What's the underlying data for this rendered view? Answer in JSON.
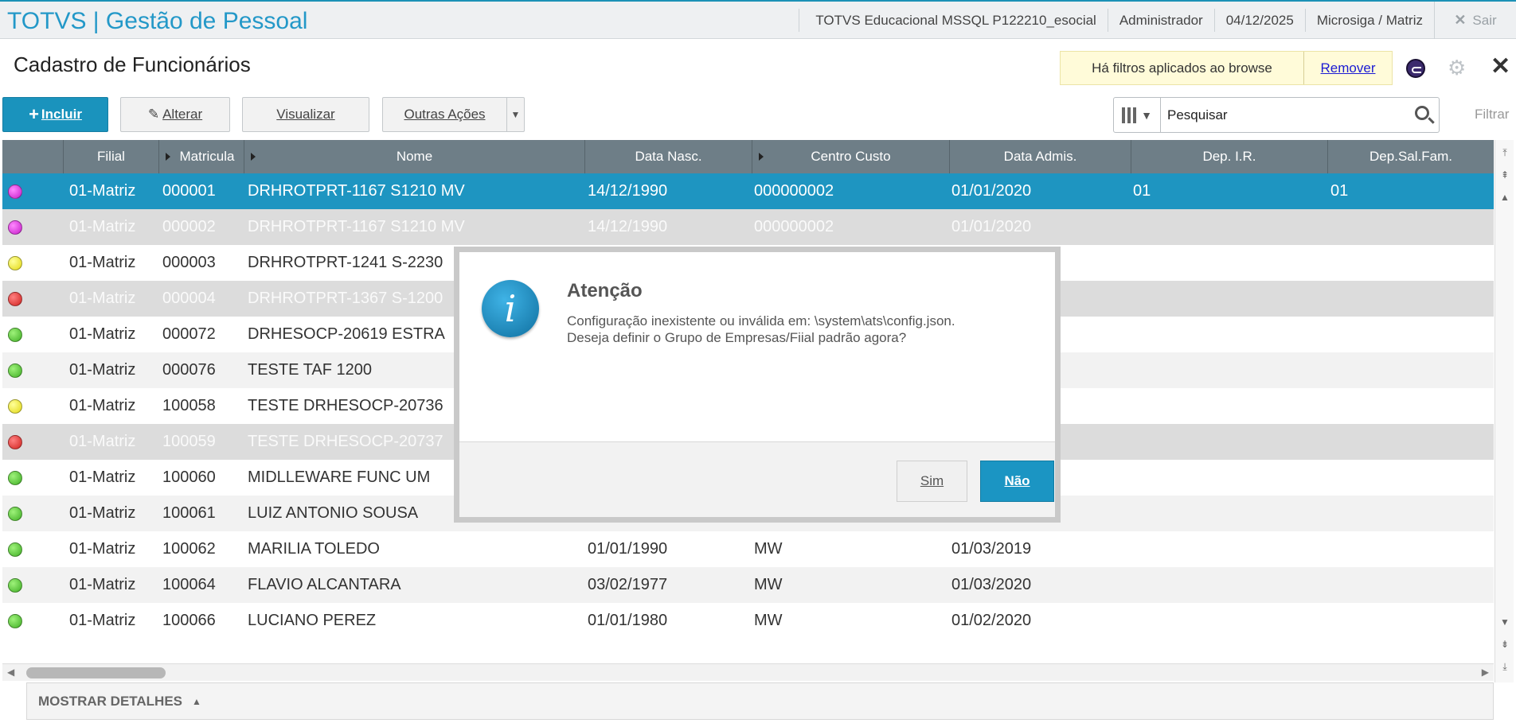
{
  "app": {
    "title": "TOTVS | Gestão de Pessoal",
    "env": "TOTVS Educacional MSSQL P122210_esocial",
    "user": "Administrador",
    "date": "04/12/2025",
    "branch": "Microsiga / Matriz",
    "exit_label": "Sair"
  },
  "page": {
    "title": "Cadastro de Funcionários",
    "filter_notice": "Há filtros aplicados ao browse",
    "filter_remove": "Remover"
  },
  "toolbar": {
    "incluir": "Incluir",
    "alterar": "Alterar",
    "visualizar": "Visualizar",
    "outras_acoes": "Outras Ações",
    "search_placeholder": "Pesquisar",
    "filtrar": "Filtrar"
  },
  "grid": {
    "columns": [
      "Filial",
      "Matricula",
      "Nome",
      "Data Nasc.",
      "Centro Custo",
      "Data Admis.",
      "Dep. I.R.",
      "Dep.Sal.Fam."
    ],
    "rows": [
      {
        "status": "magenta",
        "filial": "01-Matriz",
        "matricula": "000001",
        "nome": "DRHROTPRT-1167 S1210 MV",
        "nasc": "14/12/1990",
        "cc": "000000002",
        "admis": "01/01/2020",
        "depir": "01",
        "depsal": "01"
      },
      {
        "status": "magenta",
        "filial": "01-Matriz",
        "matricula": "000002",
        "nome": "DRHROTPRT-1167 S1210 MV",
        "nasc": "14/12/1990",
        "cc": "000000002",
        "admis": "01/01/2020",
        "depir": "",
        "depsal": ""
      },
      {
        "status": "yellow",
        "filial": "01-Matriz",
        "matricula": "000003",
        "nome": "DRHROTPRT-1241 S-2230",
        "nasc": "",
        "cc": "",
        "admis": "",
        "depir": "",
        "depsal": ""
      },
      {
        "status": "red",
        "filial": "01-Matriz",
        "matricula": "000004",
        "nome": "DRHROTPRT-1367 S-1200",
        "nasc": "",
        "cc": "",
        "admis": "",
        "depir": "",
        "depsal": ""
      },
      {
        "status": "green",
        "filial": "01-Matriz",
        "matricula": "000072",
        "nome": "DRHESOCP-20619 ESTRA",
        "nasc": "",
        "cc": "",
        "admis": "",
        "depir": "",
        "depsal": ""
      },
      {
        "status": "green",
        "filial": "01-Matriz",
        "matricula": "000076",
        "nome": "TESTE TAF 1200",
        "nasc": "",
        "cc": "",
        "admis": "",
        "depir": "",
        "depsal": ""
      },
      {
        "status": "yellow",
        "filial": "01-Matriz",
        "matricula": "100058",
        "nome": "TESTE DRHESOCP-20736",
        "nasc": "",
        "cc": "",
        "admis": "",
        "depir": "",
        "depsal": ""
      },
      {
        "status": "red",
        "filial": "01-Matriz",
        "matricula": "100059",
        "nome": "TESTE DRHESOCP-20737",
        "nasc": "",
        "cc": "",
        "admis": "",
        "depir": "",
        "depsal": ""
      },
      {
        "status": "green",
        "filial": "01-Matriz",
        "matricula": "100060",
        "nome": "MIDLLEWARE FUNC UM",
        "nasc": "",
        "cc": "",
        "admis": "",
        "depir": "",
        "depsal": ""
      },
      {
        "status": "green",
        "filial": "01-Matriz",
        "matricula": "100061",
        "nome": "LUIZ ANTONIO SOUSA",
        "nasc": "",
        "cc": "",
        "admis": "",
        "depir": "",
        "depsal": ""
      },
      {
        "status": "green",
        "filial": "01-Matriz",
        "matricula": "100062",
        "nome": "MARILIA TOLEDO",
        "nasc": "01/01/1990",
        "cc": "MW",
        "admis": "01/03/2019",
        "depir": "",
        "depsal": ""
      },
      {
        "status": "green",
        "filial": "01-Matriz",
        "matricula": "100064",
        "nome": "FLAVIO ALCANTARA",
        "nasc": "03/02/1977",
        "cc": "MW",
        "admis": "01/03/2020",
        "depir": "",
        "depsal": ""
      },
      {
        "status": "green",
        "filial": "01-Matriz",
        "matricula": "100066",
        "nome": "LUCIANO PEREZ",
        "nasc": "01/01/1980",
        "cc": "MW",
        "admis": "01/02/2020",
        "depir": "",
        "depsal": ""
      }
    ]
  },
  "details_label": "MOSTRAR DETALHES",
  "dialog": {
    "title": "Atenção",
    "line1": "Configuração inexistente ou inválida em: \\system\\ats\\config.json.",
    "line2": "Deseja definir o Grupo de Empresas/Fiial padrão agora?",
    "sim": "Sim",
    "nao": "Não"
  },
  "colors": {
    "accent": "#1e95c1",
    "header": "#6e7e87"
  }
}
